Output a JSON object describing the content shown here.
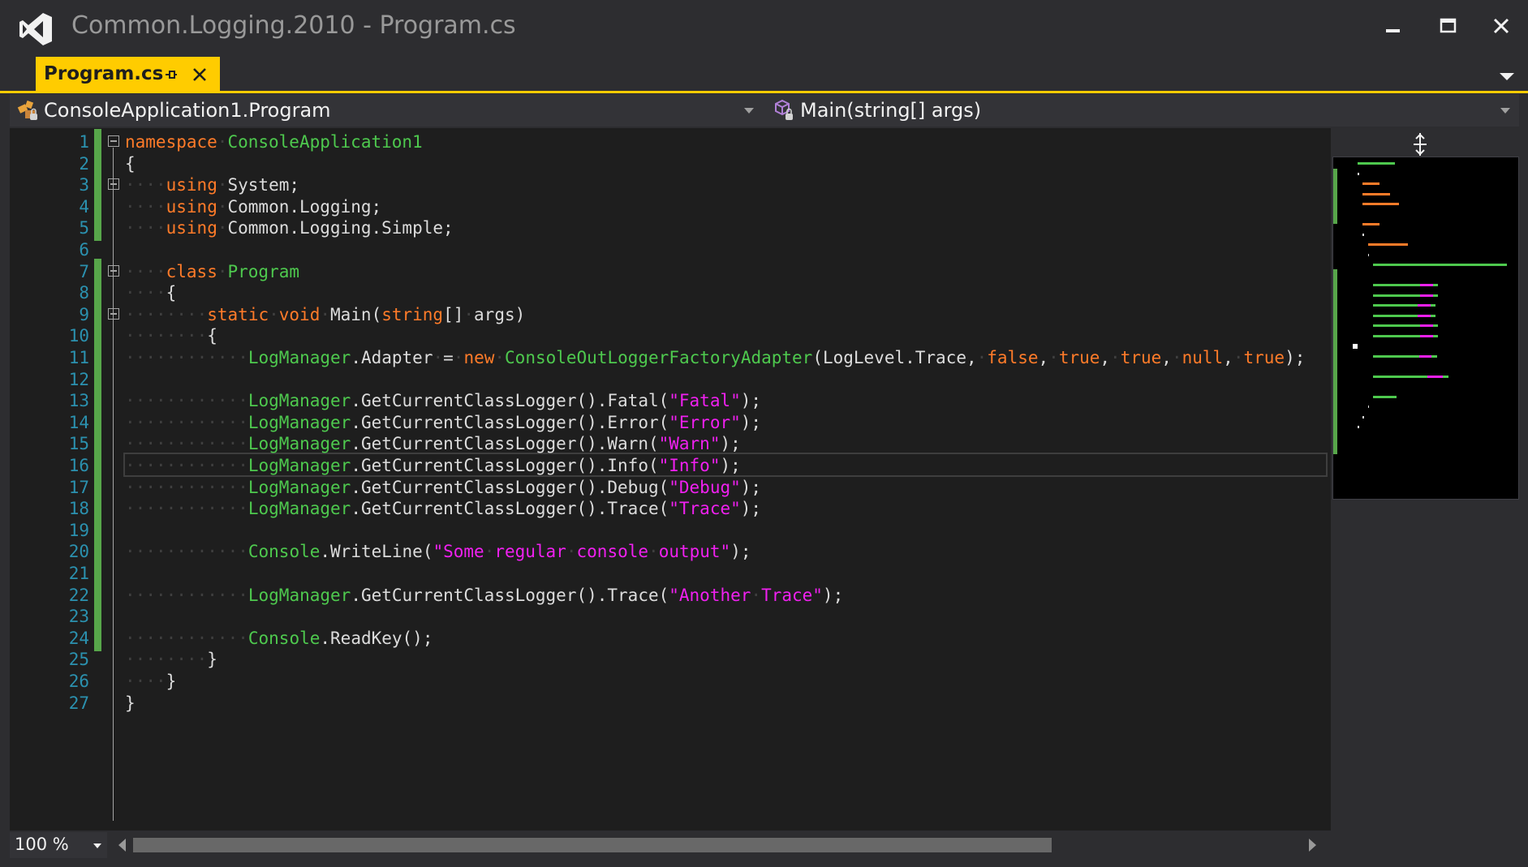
{
  "window": {
    "title": "Common.Logging.2010 - Program.cs",
    "logo_icon": "visual-studio-logo-icon",
    "controls": [
      "minimize-icon",
      "maximize-icon",
      "close-icon"
    ]
  },
  "tabs": [
    {
      "label": "Program.cs",
      "active": true,
      "icons": [
        "pin-icon",
        "close-icon"
      ]
    }
  ],
  "navbar": {
    "type_selector": "ConsoleApplication1.Program",
    "member_selector": "Main(string[] args)"
  },
  "editor": {
    "zoom": "100 %",
    "current_line": 16,
    "lines": [
      {
        "n": "1",
        "text": "namespace ConsoleApplication1",
        "fold": true,
        "changed": true
      },
      {
        "n": "2",
        "text": "{",
        "fold": false,
        "changed": true
      },
      {
        "n": "3",
        "text": "    using System;",
        "fold": true,
        "changed": true
      },
      {
        "n": "4",
        "text": "    using Common.Logging;",
        "fold": false,
        "changed": true
      },
      {
        "n": "5",
        "text": "    using Common.Logging.Simple;",
        "fold": false,
        "changed": true
      },
      {
        "n": "6",
        "text": "",
        "fold": false,
        "changed": false
      },
      {
        "n": "7",
        "text": "    class Program",
        "fold": true,
        "changed": true
      },
      {
        "n": "8",
        "text": "    {",
        "fold": false,
        "changed": true
      },
      {
        "n": "9",
        "text": "        static void Main(string[] args)",
        "fold": true,
        "changed": true
      },
      {
        "n": "10",
        "text": "        {",
        "fold": false,
        "changed": true
      },
      {
        "n": "11",
        "text": "            LogManager.Adapter = new ConsoleOutLoggerFactoryAdapter(LogLevel.Trace, false, true, true, null, true);",
        "fold": false,
        "changed": true
      },
      {
        "n": "12",
        "text": "",
        "fold": false,
        "changed": true
      },
      {
        "n": "13",
        "text": "            LogManager.GetCurrentClassLogger().Fatal(\"Fatal\");",
        "fold": false,
        "changed": true
      },
      {
        "n": "14",
        "text": "            LogManager.GetCurrentClassLogger().Error(\"Error\");",
        "fold": false,
        "changed": true
      },
      {
        "n": "15",
        "text": "            LogManager.GetCurrentClassLogger().Warn(\"Warn\");",
        "fold": false,
        "changed": true
      },
      {
        "n": "16",
        "text": "            LogManager.GetCurrentClassLogger().Info(\"Info\");",
        "fold": false,
        "changed": true
      },
      {
        "n": "17",
        "text": "            LogManager.GetCurrentClassLogger().Debug(\"Debug\");",
        "fold": false,
        "changed": true
      },
      {
        "n": "18",
        "text": "            LogManager.GetCurrentClassLogger().Trace(\"Trace\");",
        "fold": false,
        "changed": true
      },
      {
        "n": "19",
        "text": "",
        "fold": false,
        "changed": true
      },
      {
        "n": "20",
        "text": "            Console.WriteLine(\"Some regular console output\");",
        "fold": false,
        "changed": true
      },
      {
        "n": "21",
        "text": "",
        "fold": false,
        "changed": true
      },
      {
        "n": "22",
        "text": "            LogManager.GetCurrentClassLogger().Trace(\"Another Trace\");",
        "fold": false,
        "changed": true
      },
      {
        "n": "23",
        "text": "",
        "fold": false,
        "changed": true
      },
      {
        "n": "24",
        "text": "            Console.ReadKey();",
        "fold": false,
        "changed": true
      },
      {
        "n": "25",
        "text": "        }",
        "fold": false,
        "changed": false
      },
      {
        "n": "26",
        "text": "    }",
        "fold": false,
        "changed": false
      },
      {
        "n": "27",
        "text": "}",
        "fold": false,
        "changed": false
      }
    ]
  },
  "colors": {
    "keyword": "#ff7b29",
    "type": "#4ec94e",
    "string": "#f020f0",
    "plain": "#dcdcdc",
    "line_number": "#2b91af",
    "change_bar": "#57a64a",
    "tab_active": "#ffcc00"
  }
}
